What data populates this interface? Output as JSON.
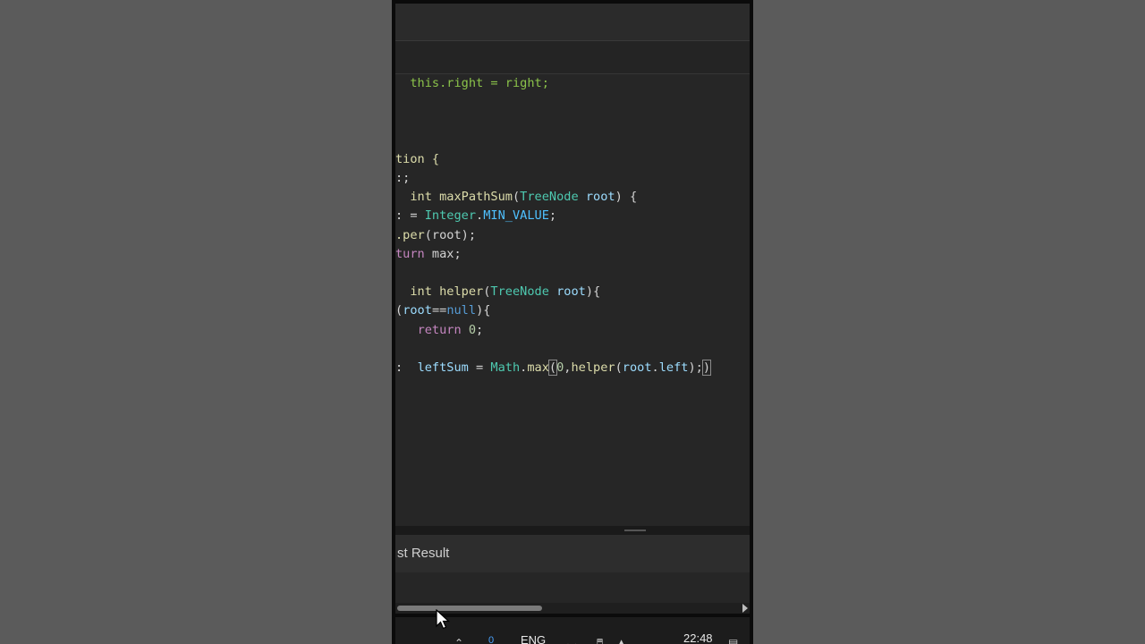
{
  "editor": {
    "lines": [
      [
        {
          "t": "  ",
          "c": "plain"
        },
        {
          "t": "this.right = right;",
          "c": "green"
        }
      ],
      [
        {
          "t": "",
          "c": "plain"
        }
      ],
      [
        {
          "t": "",
          "c": "plain"
        }
      ],
      [
        {
          "t": "",
          "c": "plain"
        }
      ],
      [
        {
          "t": "tion {",
          "c": "kw"
        }
      ],
      [
        {
          "t": ":;",
          "c": "plain"
        }
      ],
      [
        {
          "t": "  ",
          "c": "plain"
        },
        {
          "t": "int",
          "c": "kw"
        },
        {
          "t": " ",
          "c": "plain"
        },
        {
          "t": "maxPathSum",
          "c": "fn"
        },
        {
          "t": "(",
          "c": "plain"
        },
        {
          "t": "TreeNode",
          "c": "type"
        },
        {
          "t": " ",
          "c": "plain"
        },
        {
          "t": "root",
          "c": "var"
        },
        {
          "t": ") {",
          "c": "plain"
        }
      ],
      [
        {
          "t": ": = ",
          "c": "plain"
        },
        {
          "t": "Integer",
          "c": "type"
        },
        {
          "t": ".",
          "c": "plain"
        },
        {
          "t": "MIN_VALUE",
          "c": "const"
        },
        {
          "t": ";",
          "c": "plain"
        }
      ],
      [
        {
          "t": ".per",
          "c": "fn"
        },
        {
          "t": "(root);",
          "c": "plain"
        }
      ],
      [
        {
          "t": "turn",
          "c": "ctl"
        },
        {
          "t": " max;",
          "c": "plain"
        }
      ],
      [
        {
          "t": "",
          "c": "plain"
        }
      ],
      [
        {
          "t": "  ",
          "c": "plain"
        },
        {
          "t": "int",
          "c": "kw"
        },
        {
          "t": " ",
          "c": "plain"
        },
        {
          "t": "helper",
          "c": "fn"
        },
        {
          "t": "(",
          "c": "plain"
        },
        {
          "t": "TreeNode",
          "c": "type"
        },
        {
          "t": " ",
          "c": "plain"
        },
        {
          "t": "root",
          "c": "var"
        },
        {
          "t": "){",
          "c": "plain"
        }
      ],
      [
        {
          "t": "(",
          "c": "plain"
        },
        {
          "t": "root",
          "c": "var"
        },
        {
          "t": "==",
          "c": "plain"
        },
        {
          "t": "null",
          "c": "null"
        },
        {
          "t": "){",
          "c": "plain"
        }
      ],
      [
        {
          "t": "   ",
          "c": "plain"
        },
        {
          "t": "return",
          "c": "ctl"
        },
        {
          "t": " ",
          "c": "plain"
        },
        {
          "t": "0",
          "c": "num"
        },
        {
          "t": ";",
          "c": "plain"
        }
      ],
      [
        {
          "t": "",
          "c": "plain"
        }
      ],
      [
        {
          "t": ":  ",
          "c": "plain"
        },
        {
          "t": "leftSum",
          "c": "var"
        },
        {
          "t": " = ",
          "c": "plain"
        },
        {
          "t": "Math",
          "c": "type"
        },
        {
          "t": ".",
          "c": "plain"
        },
        {
          "t": "max",
          "c": "fn"
        },
        {
          "t": "(",
          "c": "box"
        },
        {
          "t": "0",
          "c": "num"
        },
        {
          "t": ",",
          "c": "plain"
        },
        {
          "t": "helper",
          "c": "fn"
        },
        {
          "t": "(",
          "c": "plain"
        },
        {
          "t": "root",
          "c": "var"
        },
        {
          "t": ".",
          "c": "plain"
        },
        {
          "t": "left",
          "c": "prop"
        },
        {
          "t": ");",
          "c": "plain"
        },
        {
          "t": ")",
          "c": "box"
        }
      ]
    ]
  },
  "panel": {
    "title": "st Result"
  },
  "taskbar": {
    "lang": "ENG",
    "time": "22:48",
    "badge": "0"
  },
  "colors": {
    "editor_bg": "#262626",
    "frame_bg": "#0b0b0b",
    "outer_bg": "#5a5a5a"
  }
}
